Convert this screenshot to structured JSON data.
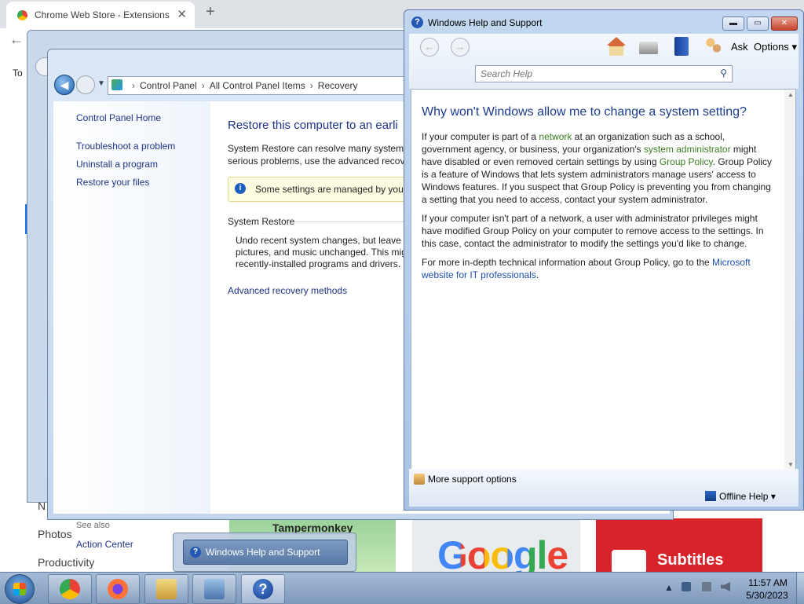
{
  "chrome": {
    "tab_title": "Chrome Web Store - Extensions",
    "tab_close": "✕",
    "new_tab": "+",
    "back": "←",
    "address_partial": "To",
    "sidebar": [
      "N",
      "Photos",
      "Productivity"
    ],
    "cards": {
      "tampermonkey": "Tampermonkey",
      "google": "Google",
      "subtitles": "Subtitles"
    }
  },
  "control_panel": {
    "breadcrumb": [
      "Control Panel",
      "All Control Panel Items",
      "Recovery"
    ],
    "left_links": {
      "home": "Control Panel Home",
      "troubleshoot": "Troubleshoot a problem",
      "uninstall": "Uninstall a program",
      "restore_files": "Restore your files"
    },
    "see_also": "See also",
    "action_center": "Action Center",
    "title": "Restore this computer to an earli",
    "description": "System Restore can resolve many system p\nserious problems, use the advanced recove",
    "info_bar": "Some settings are managed by your",
    "system_restore_heading": "System Restore",
    "system_restore_text": "Undo recent system changes, but leave f\npictures, and music unchanged. This mig\nrecently-installed programs and drivers.",
    "advanced_link": "Advanced recovery methods"
  },
  "help": {
    "window_title": "Windows Help and Support",
    "min": "▬",
    "max": "▭",
    "close": "✕",
    "ask": "Ask",
    "options": "Options",
    "options_arrow": "▾",
    "search_placeholder": "Search Help",
    "article_title": "Why won't Windows allow me to change a system setting?",
    "p1": {
      "t1": "If your computer is part of a ",
      "network": "network",
      "t2": " at an organization such as a school, government agency, or business, your organization's ",
      "sysadmin": "system administrator",
      "t3": " might have disabled or even removed certain settings by using ",
      "gp": "Group Policy",
      "t4": ". Group Policy is a feature of Windows that lets system administrators manage users' access to Windows features. If you suspect that Group Policy is preventing you from changing a setting that you need to access, contact your system administrator."
    },
    "p2": "If your computer isn't part of a network, a user with administrator privileges might have modified Group Policy on your computer to remove access to the settings. In this case, contact the administrator to modify the settings you'd like to change.",
    "p3": {
      "t1": "For more in-depth technical information about Group Policy, go to the ",
      "link": "Microsoft website for IT professionals",
      "t2": "."
    },
    "more_support": "More support options",
    "offline_help": "Offline Help",
    "offline_arrow": "▾"
  },
  "taskbar": {
    "thumb_label": "Windows Help and Support",
    "help_glyph": "?",
    "time": "11:57 AM",
    "date": "5/30/2023",
    "tray_arrow": "▲"
  }
}
